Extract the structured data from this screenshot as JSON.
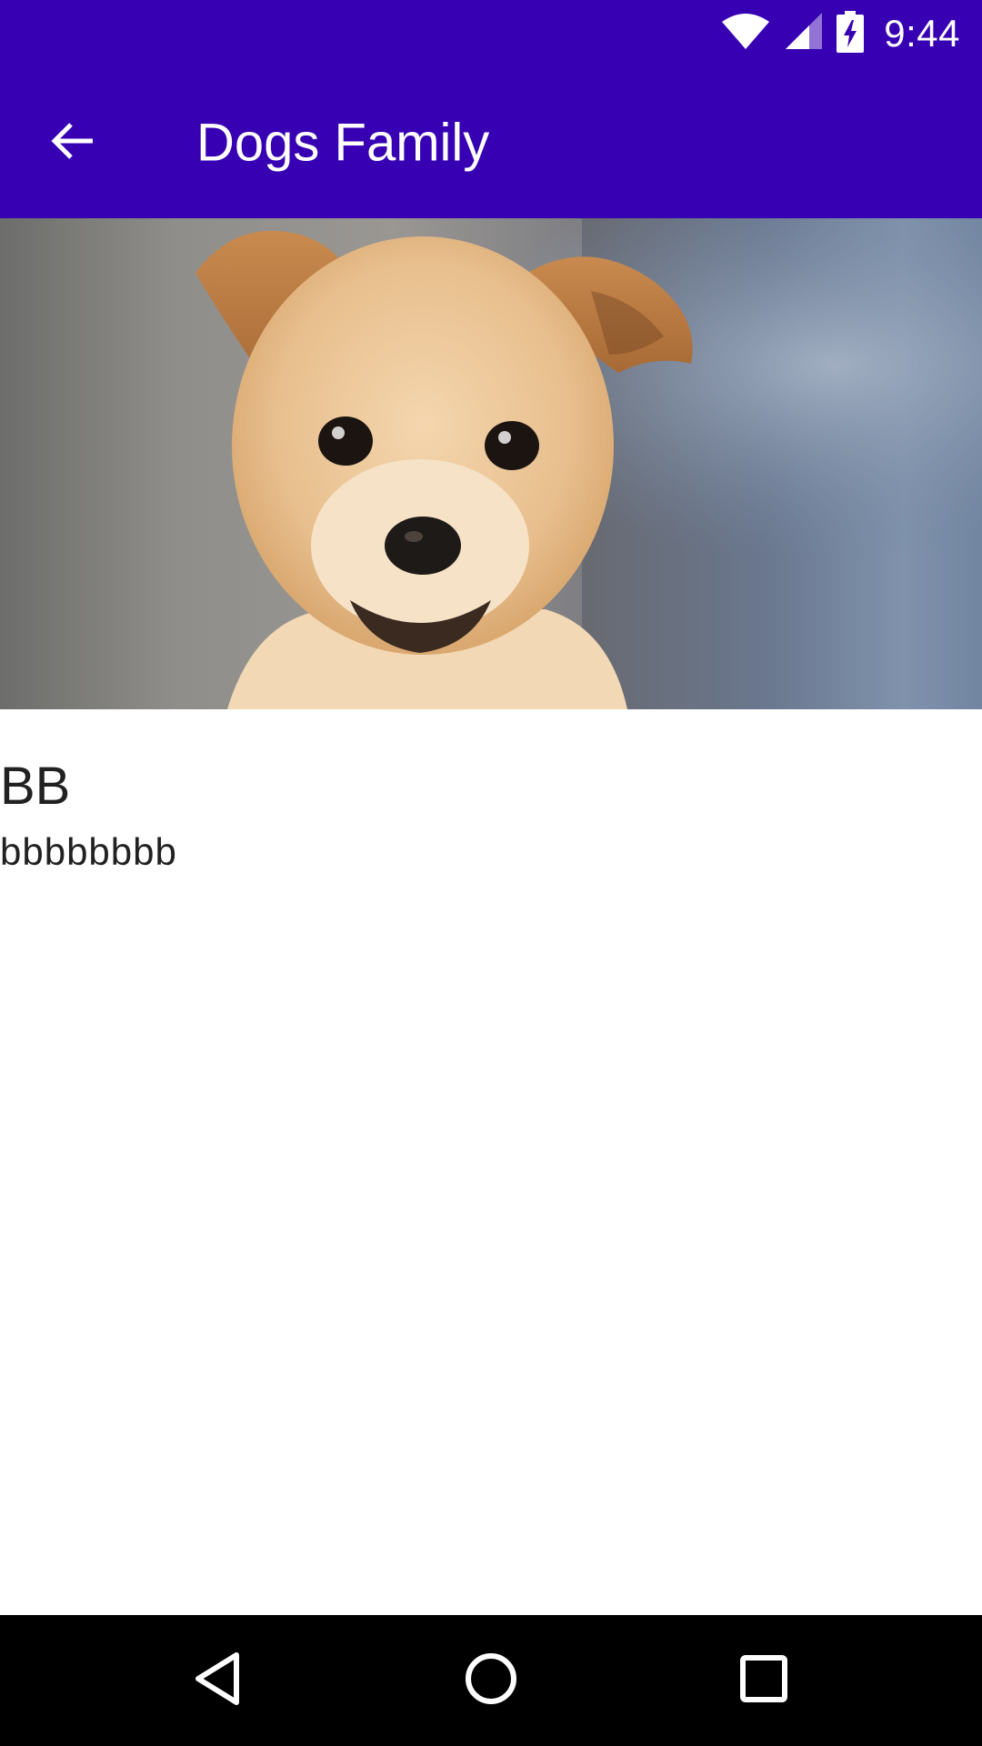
{
  "colors": {
    "primary_dark": "#3700B3",
    "primary": "#3700B3",
    "text": "#212121",
    "nav_bar": "#000000"
  },
  "status_bar": {
    "time": "9:44",
    "icons": [
      "wifi-icon",
      "cell-signal-icon",
      "battery-charging-icon"
    ]
  },
  "app_bar": {
    "title": "Dogs Family",
    "nav_icon": "arrow-back-icon"
  },
  "detail": {
    "image": "puppy-photo",
    "title": "BB",
    "description": "bbbbbbbb"
  },
  "nav_bar": {
    "icons": [
      "back-triangle-icon",
      "home-circle-icon",
      "recents-square-icon"
    ]
  }
}
